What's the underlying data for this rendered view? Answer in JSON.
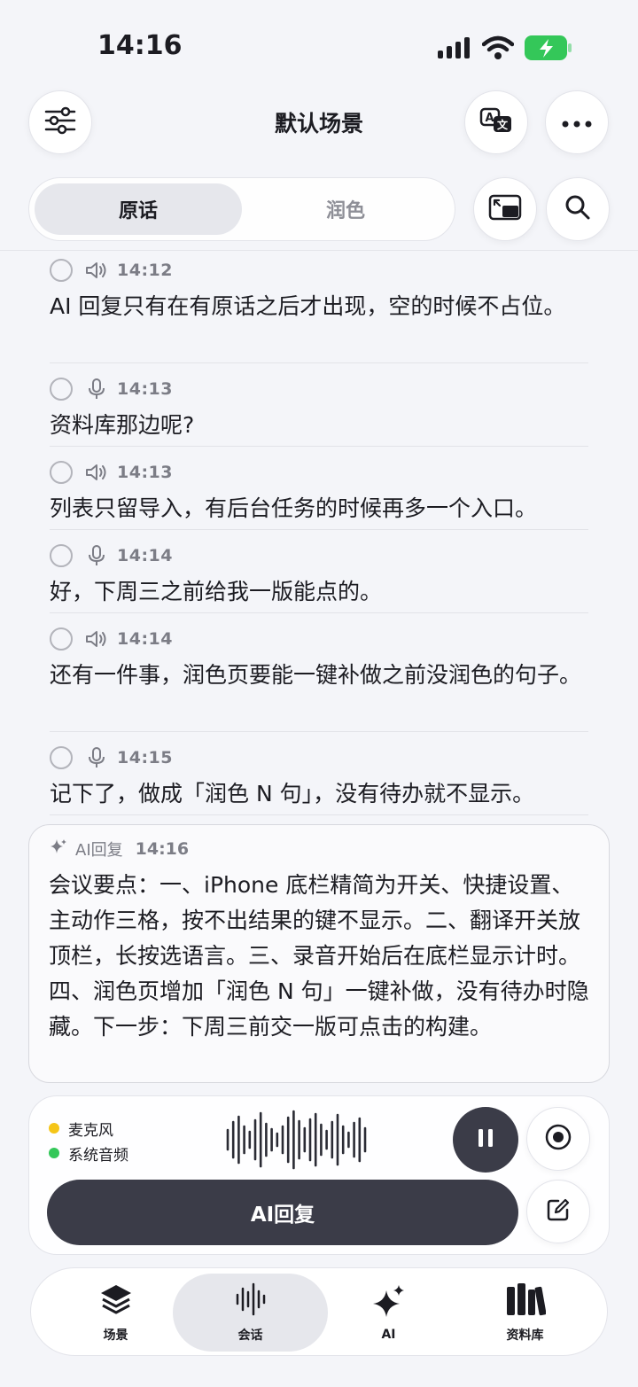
{
  "status_bar": {
    "time": "14:16"
  },
  "header": {
    "title": "默认场景",
    "icons": [
      "sliders-icon",
      "translate-icon",
      "more-icon"
    ]
  },
  "segment": {
    "original_label": "原话",
    "polish_label": "润色",
    "selected": "原话"
  },
  "transcript": [
    {
      "source": "speaker",
      "time": "14:12",
      "text": "AI 回复只有在有原话之后才出现，空的时候不占位。"
    },
    {
      "source": "mic",
      "time": "14:13",
      "text": "资料库那边呢?"
    },
    {
      "source": "speaker",
      "time": "14:13",
      "text": "列表只留导入，有后台任务的时候再多一个入口。"
    },
    {
      "source": "mic",
      "time": "14:14",
      "text": "好，下周三之前给我一版能点的。"
    },
    {
      "source": "speaker",
      "time": "14:14",
      "text": "还有一件事，润色页要能一键补做之前没润色的句子。"
    },
    {
      "source": "mic",
      "time": "14:15",
      "text": "记下了，做成「润色 N 句」，没有待办就不显示。"
    }
  ],
  "ai_reply": {
    "label": "AI回复",
    "time": "14:16",
    "text": "会议要点：一、iPhone 底栏精简为开关、快捷设置、主动作三格，按不出结果的键不显示。二、翻译开关放顶栏，长按选语言。三、录音开始后在底栏显示计时。四、润色页增加「润色 N 句」一键补做，没有待办时隐藏。下一步：下周三前交一版可点击的构建。"
  },
  "controls": {
    "sources": [
      {
        "label": "麦克风",
        "color": "#f5c518"
      },
      {
        "label": "系统音频",
        "color": "#34c759"
      }
    ],
    "ai_reply_button": "AI回复"
  },
  "tabbar": {
    "items": [
      {
        "label": "场景",
        "icon": "layers-icon"
      },
      {
        "label": "会话",
        "icon": "waveform-icon"
      },
      {
        "label": "AI",
        "icon": "sparkles-icon"
      },
      {
        "label": "资料库",
        "icon": "books-icon"
      }
    ],
    "active": "会话"
  },
  "colors": {
    "accent_dark": "#3b3c48",
    "battery_green": "#34c759",
    "mic_dot": "#f5c518",
    "system_dot": "#34c759"
  }
}
